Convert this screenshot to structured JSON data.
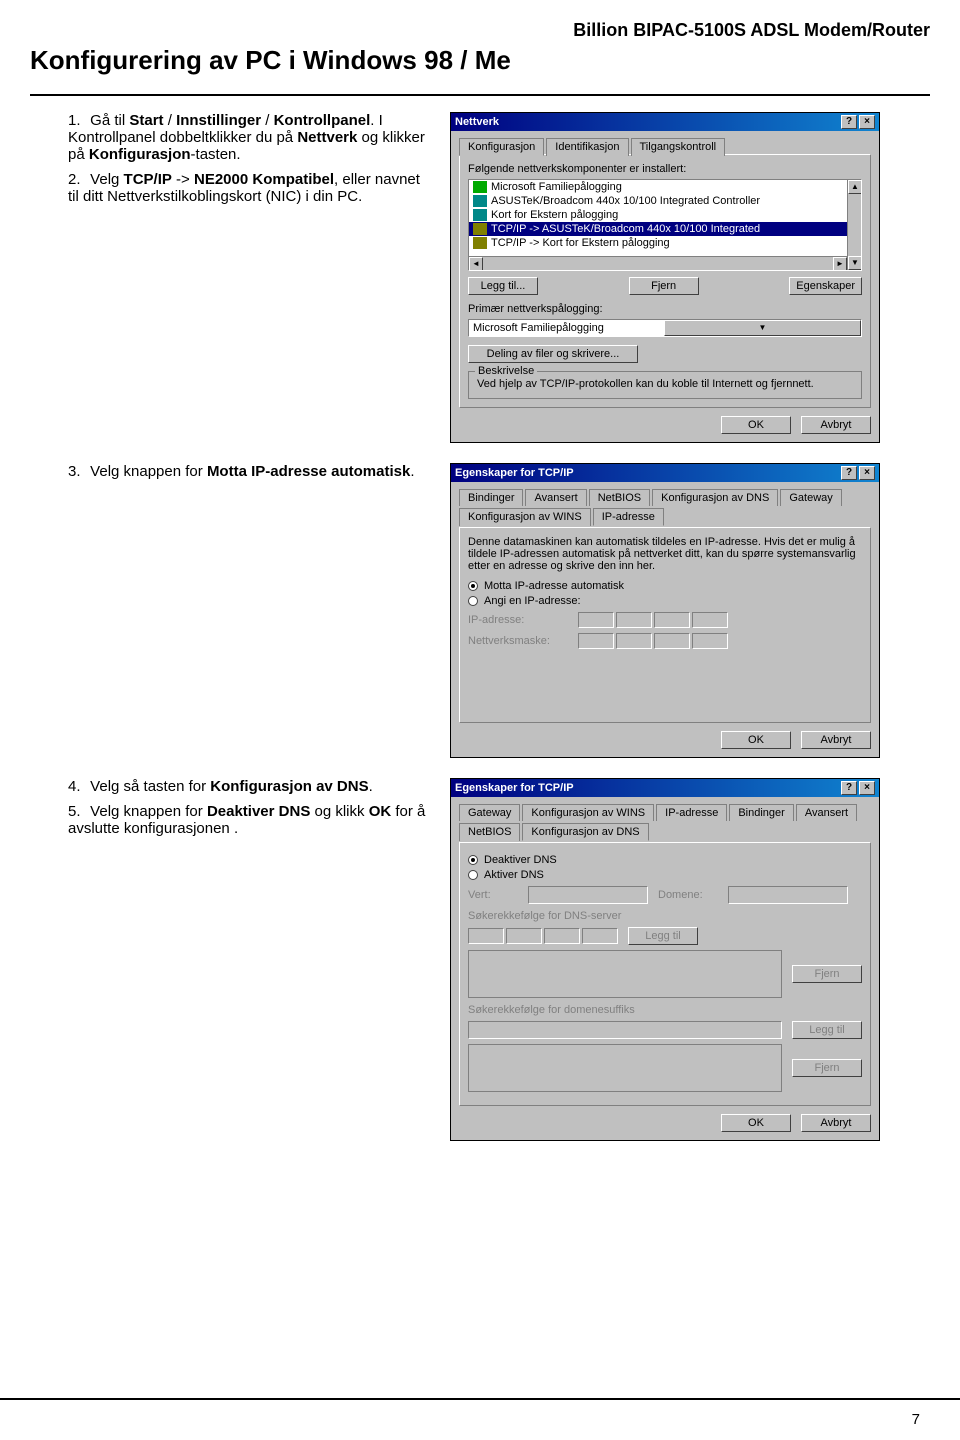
{
  "header": "Billion BIPAC-5100S ADSL Modem/Router",
  "title": "Konfigurering av PC i Windows 98 / Me",
  "page_number": "7",
  "instructions": {
    "s1a_pre": "Gå til ",
    "s1a_b1": "Start",
    "s1a_mid1": " / ",
    "s1a_b2": "Innstillinger",
    "s1a_mid2": " / ",
    "s1a_b3": "Kontrollpanel",
    "s1a_post": ". I Kontrollpanel dobbeltklikker du på ",
    "s1a_b4": "Nettverk",
    "s1a_post2": " og klikker på ",
    "s1a_b5": "Konfigurasjon",
    "s1a_post3": "-tasten.",
    "s2_pre": "Velg ",
    "s2_b1": "TCP/IP",
    "s2_mid": " -> ",
    "s2_b2": "NE2000 Kompatibel",
    "s2_post": ",  eller navnet til ditt Nettverkstilkoblingskort (NIC) i din PC.",
    "s3_pre": "Velg knappen for ",
    "s3_b1": "Motta IP-adresse automatisk",
    "s3_post": ".",
    "s4_pre": "Velg så tasten for ",
    "s4_b1": "Konfigurasjon av DNS",
    "s4_post": ".",
    "s5_pre": "Velg knappen for ",
    "s5_b1": "Deaktiver DNS",
    "s5_mid": " og klikk ",
    "s5_b2": "OK",
    "s5_post": " for å avslutte konfigurasjonen ."
  },
  "dlg1": {
    "title": "Nettverk",
    "tabs": {
      "t1": "Konfigurasjon",
      "t2": "Identifikasjon",
      "t3": "Tilgangskontroll"
    },
    "list_label": "Følgende nettverkskomponenter er installert:",
    "items": {
      "i1": "Microsoft Familiepålogging",
      "i2": "ASUSTeK/Broadcom 440x 10/100 Integrated Controller",
      "i3": "Kort for Ekstern pålogging",
      "i4": "TCP/IP -> ASUSTeK/Broadcom 440x 10/100 Integrated",
      "i5": "TCP/IP -> Kort for Ekstern pålogging"
    },
    "btn_add": "Legg til...",
    "btn_remove": "Fjern",
    "btn_props": "Egenskaper",
    "primary_label": "Primær nettverkspålogging:",
    "primary_value": "Microsoft Familiepålogging",
    "btn_share": "Deling av filer og skrivere...",
    "desc_label": "Beskrivelse",
    "desc_text": "Ved hjelp av TCP/IP-protokollen kan du koble til Internett og fjernnett.",
    "ok": "OK",
    "cancel": "Avbryt"
  },
  "dlg2": {
    "title": "Egenskaper for TCP/IP",
    "tabs": {
      "t1": "Bindinger",
      "t2": "Avansert",
      "t3": "NetBIOS",
      "t4": "Konfigurasjon av DNS",
      "t5": "Gateway",
      "t6": "Konfigurasjon av WINS",
      "t7": "IP-adresse"
    },
    "intro": "Denne datamaskinen kan automatisk tildeles en IP-adresse. Hvis det er mulig å tildele IP-adressen automatisk på nettverket ditt, kan du spørre systemansvarlig etter en adresse og skrive den inn her.",
    "r1": "Motta IP-adresse automatisk",
    "r2": "Angi en IP-adresse:",
    "ip_label": "IP-adresse:",
    "mask_label": "Nettverksmaske:",
    "ok": "OK",
    "cancel": "Avbryt"
  },
  "dlg3": {
    "title": "Egenskaper for TCP/IP",
    "tabs": {
      "t1": "Gateway",
      "t2": "Konfigurasjon av WINS",
      "t3": "IP-adresse",
      "t4": "Bindinger",
      "t5": "Avansert",
      "t6": "NetBIOS",
      "t7": "Konfigurasjon av DNS"
    },
    "r1": "Deaktiver DNS",
    "r2": "Aktiver DNS",
    "host_label": "Vert:",
    "domain_label": "Domene:",
    "dns_order_label": "Søkerekkefølge for DNS-server",
    "suffix_order_label": "Søkerekkefølge for domenesuffiks",
    "btn_add": "Legg til",
    "btn_remove": "Fjern",
    "ok": "OK",
    "cancel": "Avbryt"
  }
}
